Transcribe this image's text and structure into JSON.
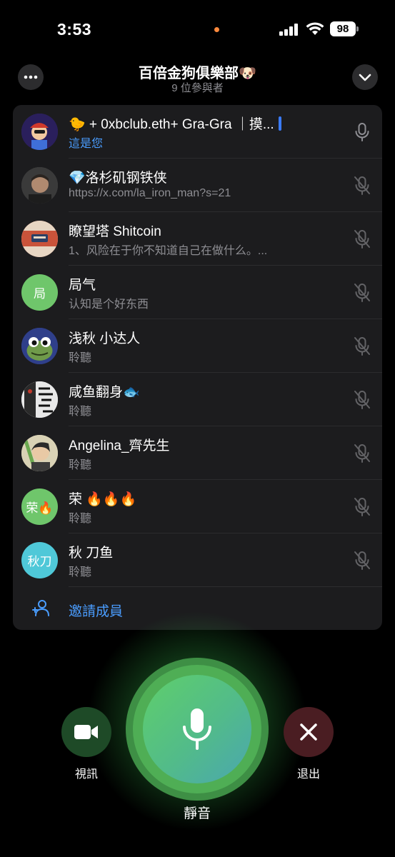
{
  "status_bar": {
    "time": "3:53",
    "battery": "98"
  },
  "header": {
    "title": "百倍金狗俱樂部🐶",
    "subtitle": "9 位參與者",
    "more_icon": "more-dots-icon",
    "collapse_icon": "chevron-down-icon"
  },
  "participants": [
    {
      "name": "🐤 + 0xbclub.eth+ Gra-Gra ｜摸...",
      "status": "這是您",
      "is_self": true,
      "muted": false,
      "avatar_text": "",
      "avatar_color": "#3b2a6e"
    },
    {
      "name": "💎洛杉矶钢铁侠",
      "status": "https://x.com/la_iron_man?s=21",
      "is_self": false,
      "muted": true,
      "avatar_text": "",
      "avatar_color": "#4a4a4a"
    },
    {
      "name": "瞭望塔 Shitcoin",
      "status": "1、风险在于你不知道自己在做什么。...",
      "is_self": false,
      "muted": true,
      "avatar_text": "",
      "avatar_color": "#c9533a"
    },
    {
      "name": "局气",
      "status": "认知是个好东西",
      "is_self": false,
      "muted": true,
      "avatar_text": "局",
      "avatar_color": "#6fc66b"
    },
    {
      "name": "浅秋 小达人",
      "status": "聆聽",
      "is_self": false,
      "muted": true,
      "avatar_text": "",
      "avatar_color": "#2f3f8a"
    },
    {
      "name": "咸鱼翻身🐟",
      "status": "聆聽",
      "is_self": false,
      "muted": true,
      "avatar_text": "",
      "avatar_color": "#d8d8d8"
    },
    {
      "name": "Angelina_齊先生",
      "status": "聆聽",
      "is_self": false,
      "muted": true,
      "avatar_text": "",
      "avatar_color": "#c9c3a6"
    },
    {
      "name": "荣 🔥🔥🔥",
      "status": "聆聽",
      "is_self": false,
      "muted": true,
      "avatar_text": "荣🔥",
      "avatar_color": "#6fc66b"
    },
    {
      "name": "秋 刀鱼",
      "status": "聆聽",
      "is_self": false,
      "muted": true,
      "avatar_text": "秋刀",
      "avatar_color": "#4fc8d8"
    }
  ],
  "invite": {
    "label": "邀請成員",
    "icon": "add-person-icon"
  },
  "controls": {
    "video_label": "視訊",
    "mute_label": "靜音",
    "leave_label": "退出"
  },
  "colors": {
    "accent": "#4a9dff",
    "panel": "#1c1c1e",
    "mute_green": "#5fcf6b",
    "leave_red": "#4a1d22"
  }
}
